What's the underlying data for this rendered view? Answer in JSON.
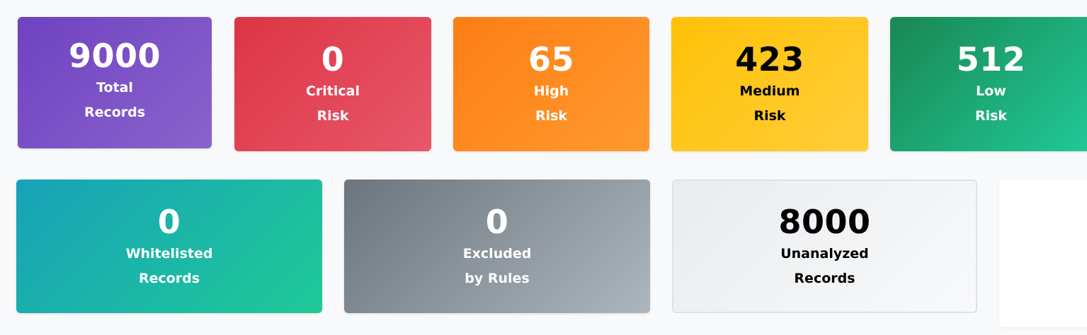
{
  "stats": {
    "total": {
      "value": "9000",
      "line1": "Total",
      "line2": "Records",
      "color": "#6f42c1"
    },
    "critical": {
      "value": "0",
      "line1": "Critical",
      "line2": "Risk",
      "color": "#dc3545"
    },
    "high": {
      "value": "65",
      "line1": "High",
      "line2": "Risk",
      "color": "#fd7e14"
    },
    "medium": {
      "value": "423",
      "line1": "Medium",
      "line2": "Risk",
      "color": "#ffc107"
    },
    "low": {
      "value": "512",
      "line1": "Low",
      "line2": "Risk",
      "color": "#198754"
    },
    "whitelisted": {
      "value": "0",
      "line1": "Whitelisted",
      "line2": "Records",
      "color": "#17a2b8"
    },
    "excluded": {
      "value": "0",
      "line1": "Excluded",
      "line2": "by Rules",
      "color": "#6c757d"
    },
    "unanalyzed": {
      "value": "8000",
      "line1": "Unanalyzed",
      "line2": "Records",
      "color": "#e9ecef"
    }
  }
}
